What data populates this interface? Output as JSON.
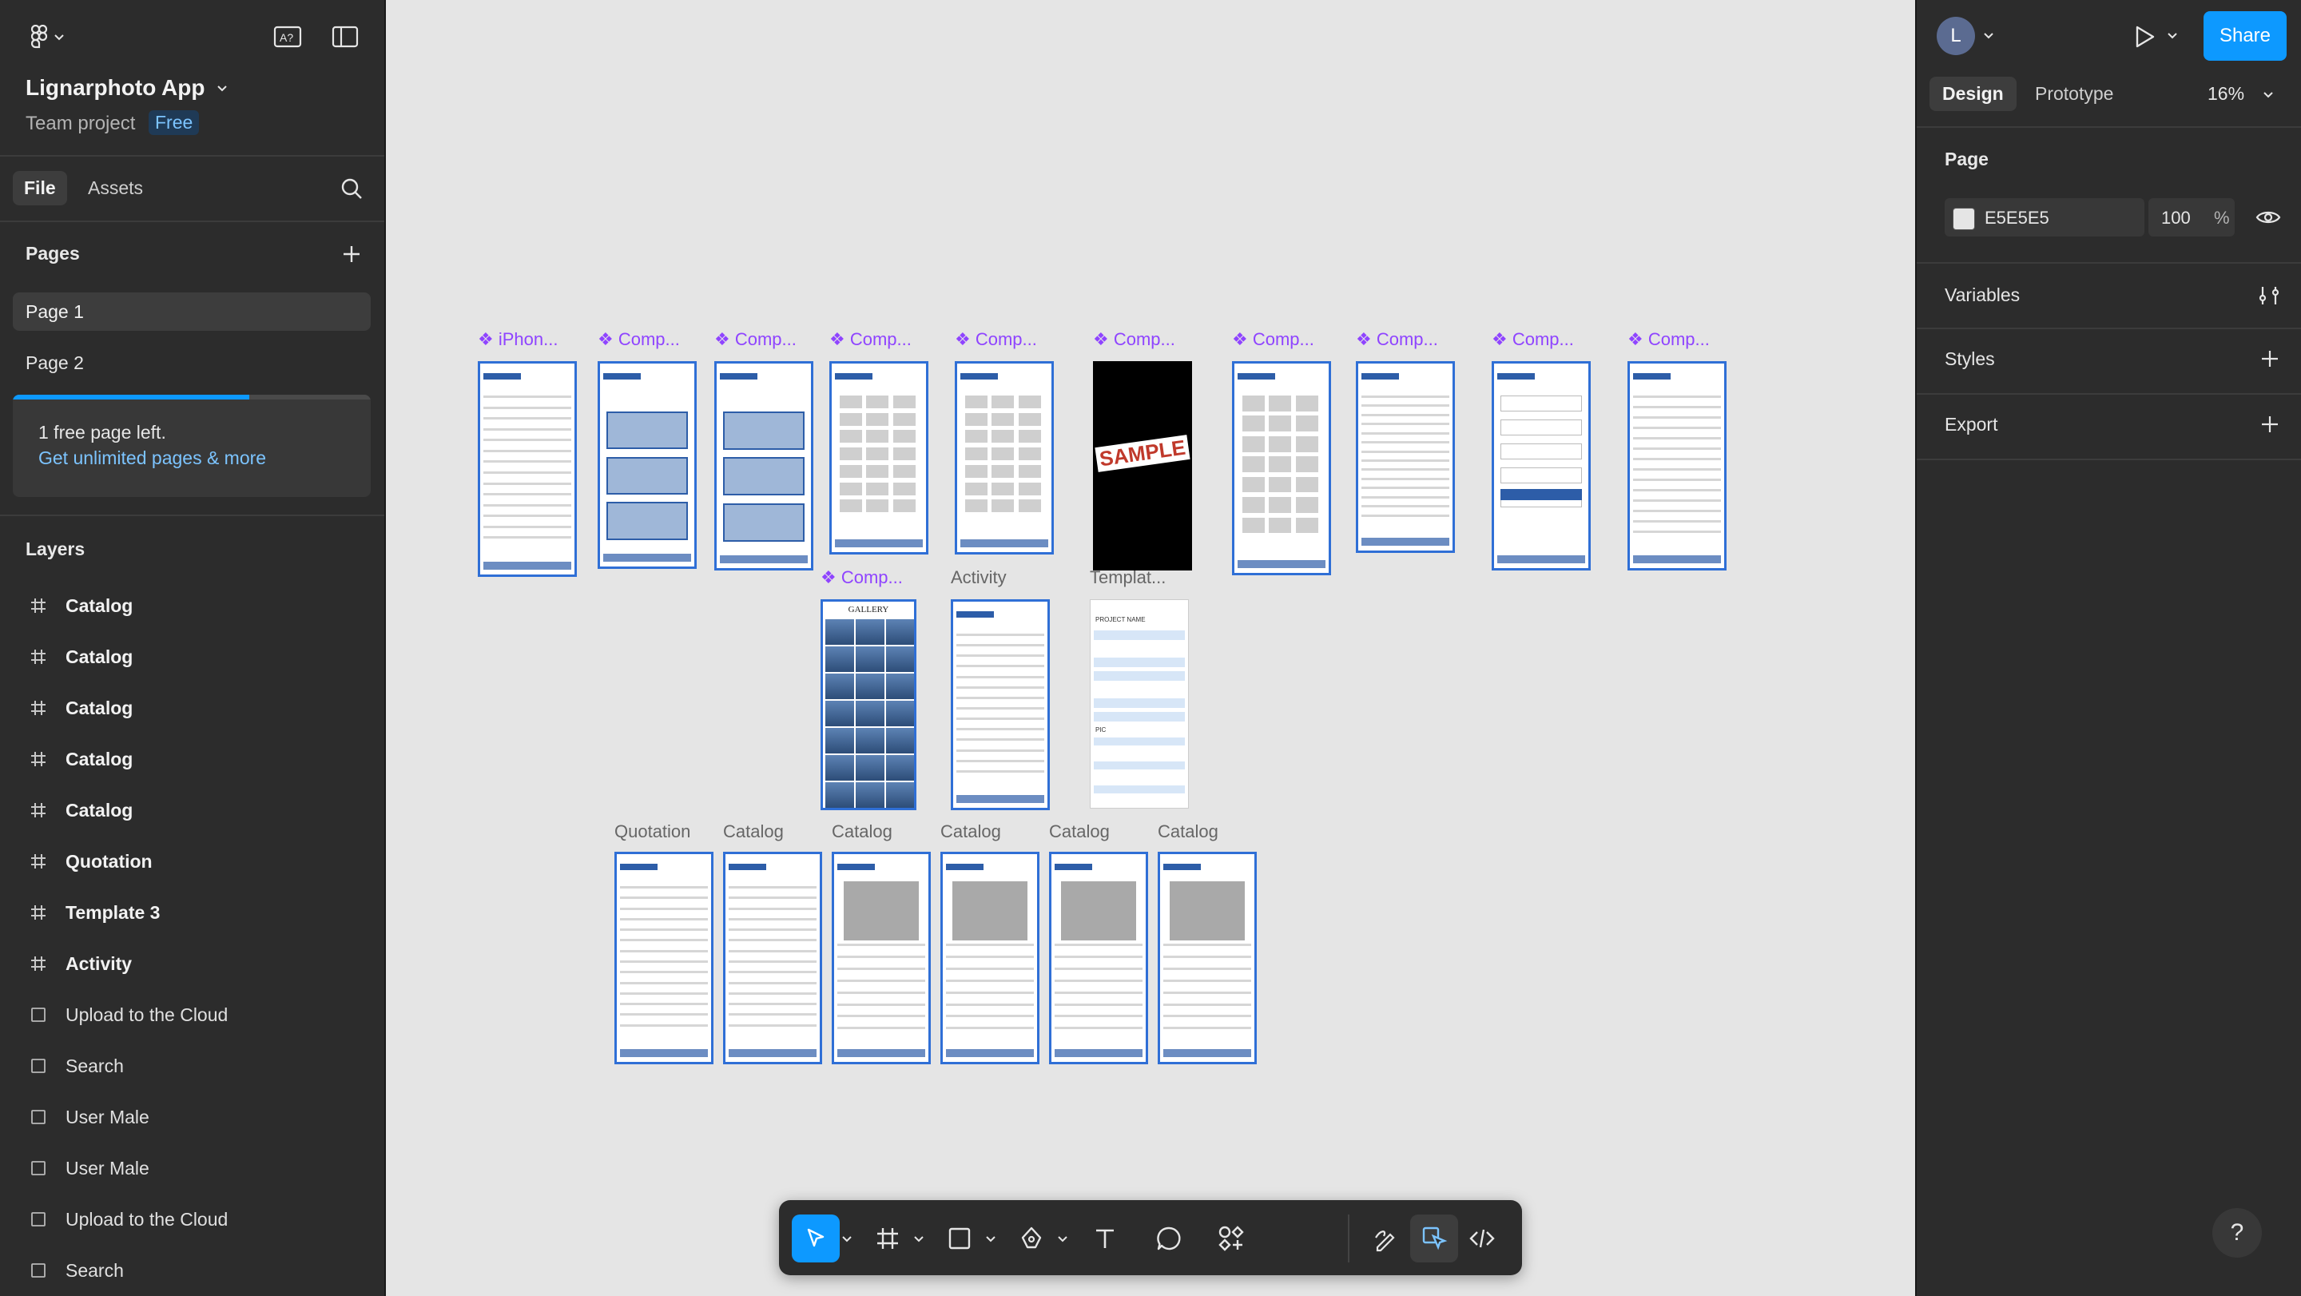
{
  "app": {
    "project_name": "Lignarphoto App",
    "team_label": "Team project",
    "plan_badge": "Free"
  },
  "left_tabs": {
    "file": "File",
    "assets": "Assets"
  },
  "pages": {
    "header": "Pages",
    "items": [
      "Page 1",
      "Page 2"
    ],
    "notice": "1 free page left.",
    "upgrade_link": "Get unlimited pages & more"
  },
  "layers": {
    "header": "Layers",
    "items": [
      {
        "label": "Catalog",
        "type": "frame"
      },
      {
        "label": "Catalog",
        "type": "frame"
      },
      {
        "label": "Catalog",
        "type": "frame"
      },
      {
        "label": "Catalog",
        "type": "frame"
      },
      {
        "label": "Catalog",
        "type": "frame"
      },
      {
        "label": "Quotation",
        "type": "frame"
      },
      {
        "label": "Template 3",
        "type": "frame"
      },
      {
        "label": "Activity",
        "type": "frame"
      },
      {
        "label": "Upload to the Cloud",
        "type": "image"
      },
      {
        "label": "Search",
        "type": "image"
      },
      {
        "label": "User Male",
        "type": "image"
      },
      {
        "label": "User Male",
        "type": "image"
      },
      {
        "label": "Upload to the Cloud",
        "type": "image"
      },
      {
        "label": "Search",
        "type": "image"
      }
    ]
  },
  "header_right": {
    "avatar_initial": "L",
    "share": "Share",
    "tab_design": "Design",
    "tab_prototype": "Prototype",
    "zoom": "16%"
  },
  "page_props": {
    "header": "Page",
    "bg_color": "E5E5E5",
    "opacity": "100",
    "percent": "%",
    "variables": "Variables",
    "styles": "Styles",
    "export": "Export"
  },
  "canvas": {
    "row1": [
      "iPhon...",
      "Comp...",
      "Comp...",
      "Comp...",
      "Comp...",
      "Comp...",
      "Comp...",
      "Comp...",
      "Comp...",
      "Comp..."
    ],
    "row2": [
      "Comp...",
      "Activity",
      "Templat..."
    ],
    "row3": [
      "Quotation",
      "Catalog",
      "Catalog",
      "Catalog",
      "Catalog",
      "Catalog"
    ],
    "sample_text": "SAMPLE",
    "gallery_text": "GALLERY",
    "project_name_text": "PROJECT NAME",
    "pic_text": "PIC"
  },
  "colors": {
    "canvas_bg": "#e5e5e5",
    "panel_bg": "#2c2c2c",
    "accent": "#0d99ff",
    "component": "#8f44ff",
    "frame_border": "#2f6fd6"
  },
  "help": "?"
}
